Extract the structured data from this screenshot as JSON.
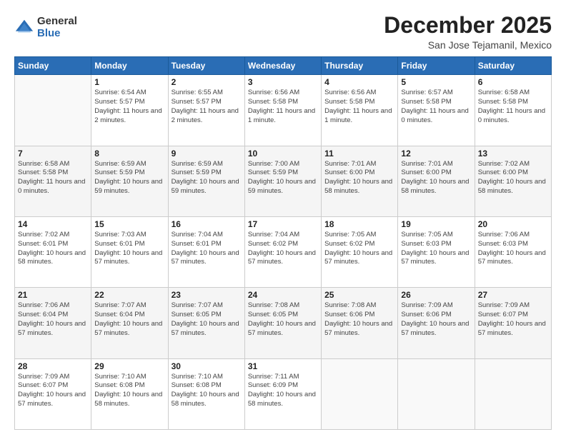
{
  "logo": {
    "general": "General",
    "blue": "Blue"
  },
  "title": "December 2025",
  "location": "San Jose Tejamanil, Mexico",
  "days_header": [
    "Sunday",
    "Monday",
    "Tuesday",
    "Wednesday",
    "Thursday",
    "Friday",
    "Saturday"
  ],
  "weeks": [
    [
      {
        "day": "",
        "sunrise": "",
        "sunset": "",
        "daylight": ""
      },
      {
        "day": "1",
        "sunrise": "Sunrise: 6:54 AM",
        "sunset": "Sunset: 5:57 PM",
        "daylight": "Daylight: 11 hours and 2 minutes."
      },
      {
        "day": "2",
        "sunrise": "Sunrise: 6:55 AM",
        "sunset": "Sunset: 5:57 PM",
        "daylight": "Daylight: 11 hours and 2 minutes."
      },
      {
        "day": "3",
        "sunrise": "Sunrise: 6:56 AM",
        "sunset": "Sunset: 5:58 PM",
        "daylight": "Daylight: 11 hours and 1 minute."
      },
      {
        "day": "4",
        "sunrise": "Sunrise: 6:56 AM",
        "sunset": "Sunset: 5:58 PM",
        "daylight": "Daylight: 11 hours and 1 minute."
      },
      {
        "day": "5",
        "sunrise": "Sunrise: 6:57 AM",
        "sunset": "Sunset: 5:58 PM",
        "daylight": "Daylight: 11 hours and 0 minutes."
      },
      {
        "day": "6",
        "sunrise": "Sunrise: 6:58 AM",
        "sunset": "Sunset: 5:58 PM",
        "daylight": "Daylight: 11 hours and 0 minutes."
      }
    ],
    [
      {
        "day": "7",
        "sunrise": "Sunrise: 6:58 AM",
        "sunset": "Sunset: 5:58 PM",
        "daylight": "Daylight: 11 hours and 0 minutes."
      },
      {
        "day": "8",
        "sunrise": "Sunrise: 6:59 AM",
        "sunset": "Sunset: 5:59 PM",
        "daylight": "Daylight: 10 hours and 59 minutes."
      },
      {
        "day": "9",
        "sunrise": "Sunrise: 6:59 AM",
        "sunset": "Sunset: 5:59 PM",
        "daylight": "Daylight: 10 hours and 59 minutes."
      },
      {
        "day": "10",
        "sunrise": "Sunrise: 7:00 AM",
        "sunset": "Sunset: 5:59 PM",
        "daylight": "Daylight: 10 hours and 59 minutes."
      },
      {
        "day": "11",
        "sunrise": "Sunrise: 7:01 AM",
        "sunset": "Sunset: 6:00 PM",
        "daylight": "Daylight: 10 hours and 58 minutes."
      },
      {
        "day": "12",
        "sunrise": "Sunrise: 7:01 AM",
        "sunset": "Sunset: 6:00 PM",
        "daylight": "Daylight: 10 hours and 58 minutes."
      },
      {
        "day": "13",
        "sunrise": "Sunrise: 7:02 AM",
        "sunset": "Sunset: 6:00 PM",
        "daylight": "Daylight: 10 hours and 58 minutes."
      }
    ],
    [
      {
        "day": "14",
        "sunrise": "Sunrise: 7:02 AM",
        "sunset": "Sunset: 6:01 PM",
        "daylight": "Daylight: 10 hours and 58 minutes."
      },
      {
        "day": "15",
        "sunrise": "Sunrise: 7:03 AM",
        "sunset": "Sunset: 6:01 PM",
        "daylight": "Daylight: 10 hours and 57 minutes."
      },
      {
        "day": "16",
        "sunrise": "Sunrise: 7:04 AM",
        "sunset": "Sunset: 6:01 PM",
        "daylight": "Daylight: 10 hours and 57 minutes."
      },
      {
        "day": "17",
        "sunrise": "Sunrise: 7:04 AM",
        "sunset": "Sunset: 6:02 PM",
        "daylight": "Daylight: 10 hours and 57 minutes."
      },
      {
        "day": "18",
        "sunrise": "Sunrise: 7:05 AM",
        "sunset": "Sunset: 6:02 PM",
        "daylight": "Daylight: 10 hours and 57 minutes."
      },
      {
        "day": "19",
        "sunrise": "Sunrise: 7:05 AM",
        "sunset": "Sunset: 6:03 PM",
        "daylight": "Daylight: 10 hours and 57 minutes."
      },
      {
        "day": "20",
        "sunrise": "Sunrise: 7:06 AM",
        "sunset": "Sunset: 6:03 PM",
        "daylight": "Daylight: 10 hours and 57 minutes."
      }
    ],
    [
      {
        "day": "21",
        "sunrise": "Sunrise: 7:06 AM",
        "sunset": "Sunset: 6:04 PM",
        "daylight": "Daylight: 10 hours and 57 minutes."
      },
      {
        "day": "22",
        "sunrise": "Sunrise: 7:07 AM",
        "sunset": "Sunset: 6:04 PM",
        "daylight": "Daylight: 10 hours and 57 minutes."
      },
      {
        "day": "23",
        "sunrise": "Sunrise: 7:07 AM",
        "sunset": "Sunset: 6:05 PM",
        "daylight": "Daylight: 10 hours and 57 minutes."
      },
      {
        "day": "24",
        "sunrise": "Sunrise: 7:08 AM",
        "sunset": "Sunset: 6:05 PM",
        "daylight": "Daylight: 10 hours and 57 minutes."
      },
      {
        "day": "25",
        "sunrise": "Sunrise: 7:08 AM",
        "sunset": "Sunset: 6:06 PM",
        "daylight": "Daylight: 10 hours and 57 minutes."
      },
      {
        "day": "26",
        "sunrise": "Sunrise: 7:09 AM",
        "sunset": "Sunset: 6:06 PM",
        "daylight": "Daylight: 10 hours and 57 minutes."
      },
      {
        "day": "27",
        "sunrise": "Sunrise: 7:09 AM",
        "sunset": "Sunset: 6:07 PM",
        "daylight": "Daylight: 10 hours and 57 minutes."
      }
    ],
    [
      {
        "day": "28",
        "sunrise": "Sunrise: 7:09 AM",
        "sunset": "Sunset: 6:07 PM",
        "daylight": "Daylight: 10 hours and 57 minutes."
      },
      {
        "day": "29",
        "sunrise": "Sunrise: 7:10 AM",
        "sunset": "Sunset: 6:08 PM",
        "daylight": "Daylight: 10 hours and 58 minutes."
      },
      {
        "day": "30",
        "sunrise": "Sunrise: 7:10 AM",
        "sunset": "Sunset: 6:08 PM",
        "daylight": "Daylight: 10 hours and 58 minutes."
      },
      {
        "day": "31",
        "sunrise": "Sunrise: 7:11 AM",
        "sunset": "Sunset: 6:09 PM",
        "daylight": "Daylight: 10 hours and 58 minutes."
      },
      {
        "day": "",
        "sunrise": "",
        "sunset": "",
        "daylight": ""
      },
      {
        "day": "",
        "sunrise": "",
        "sunset": "",
        "daylight": ""
      },
      {
        "day": "",
        "sunrise": "",
        "sunset": "",
        "daylight": ""
      }
    ]
  ]
}
